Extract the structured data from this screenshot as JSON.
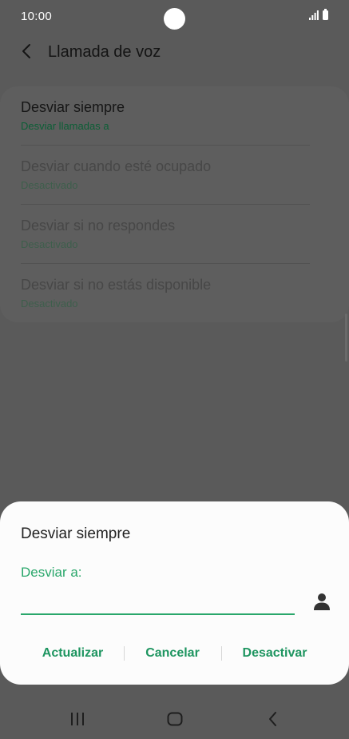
{
  "status_bar": {
    "time": "10:00"
  },
  "app_bar": {
    "title": "Llamada de voz"
  },
  "settings": {
    "items": [
      {
        "title": "Desviar siempre",
        "subtitle": "Desviar llamadas a"
      },
      {
        "title": "Desviar cuando esté ocupado",
        "subtitle": "Desactivado"
      },
      {
        "title": "Desviar si no respondes",
        "subtitle": "Desactivado"
      },
      {
        "title": "Desviar si no estás disponible",
        "subtitle": "Desactivado"
      }
    ]
  },
  "dialog": {
    "title": "Desviar siempre",
    "field_label": "Desviar a:",
    "field_value": "",
    "buttons": {
      "update": "Actualizar",
      "cancel": "Cancelar",
      "deactivate": "Desactivar"
    }
  },
  "colors": {
    "accent": "#2aa76b",
    "overlay": "#5a5a5a",
    "dialog_bg": "#fcfcfc"
  },
  "icons": {
    "back": "chevron-left-icon",
    "contact": "person-icon",
    "nav_recents": "recents-icon",
    "nav_home": "home-icon",
    "nav_back": "nav-back-icon"
  }
}
